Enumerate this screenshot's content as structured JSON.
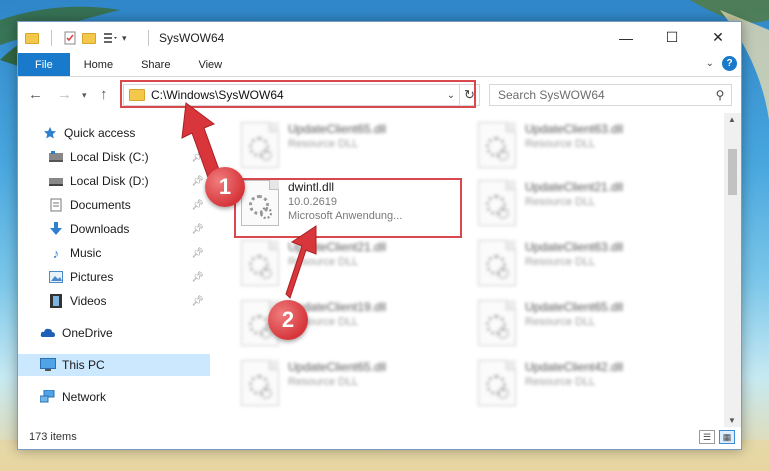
{
  "window": {
    "title": "SysWOW64"
  },
  "ribbon": {
    "tabs": [
      "File",
      "Home",
      "Share",
      "View"
    ],
    "help": "?"
  },
  "nav": {
    "address": "C:\\Windows\\SysWOW64",
    "search_placeholder": "Search SysWOW64"
  },
  "sidebar": {
    "items": [
      {
        "label": "Quick access",
        "icon": "star-icon"
      },
      {
        "label": "Local Disk (C:)",
        "icon": "drive-icon"
      },
      {
        "label": "Local Disk (D:)",
        "icon": "drive-icon"
      },
      {
        "label": "Documents",
        "icon": "document-icon"
      },
      {
        "label": "Downloads",
        "icon": "download-icon"
      },
      {
        "label": "Music",
        "icon": "music-icon"
      },
      {
        "label": "Pictures",
        "icon": "picture-icon"
      },
      {
        "label": "Videos",
        "icon": "video-icon"
      },
      {
        "label": "OneDrive",
        "icon": "cloud-icon"
      },
      {
        "label": "This PC",
        "icon": "computer-icon"
      },
      {
        "label": "Network",
        "icon": "network-icon"
      }
    ]
  },
  "files": [
    {
      "name": "UpdateClient65.dll",
      "sub": "Resource DLL"
    },
    {
      "name": "UpdateClient63.dll",
      "sub": "Resource DLL"
    },
    {
      "name": "dwintl.dll",
      "sub": "10.0.2619",
      "sub2": "Microsoft Anwendung..."
    },
    {
      "name": "UpdateClient21.dll",
      "sub": "Resource DLL"
    },
    {
      "name": "UpdateClient21.dll",
      "sub": "Resource DLL"
    },
    {
      "name": "UpdateClient63.dll",
      "sub": "Resource DLL"
    },
    {
      "name": "UpdateClient19.dll",
      "sub": "Resource DLL"
    },
    {
      "name": "UpdateClient65.dll",
      "sub": "Resource DLL"
    },
    {
      "name": "UpdateClient65.dll",
      "sub": "Resource DLL"
    },
    {
      "name": "UpdateClient42.dll",
      "sub": "Resource DLL"
    }
  ],
  "status": {
    "items": "173 items"
  },
  "annotations": {
    "step1": "1",
    "step2": "2"
  },
  "colors": {
    "accent": "#1979ca",
    "highlight": "#d9484d",
    "selected": "#cce8ff"
  }
}
